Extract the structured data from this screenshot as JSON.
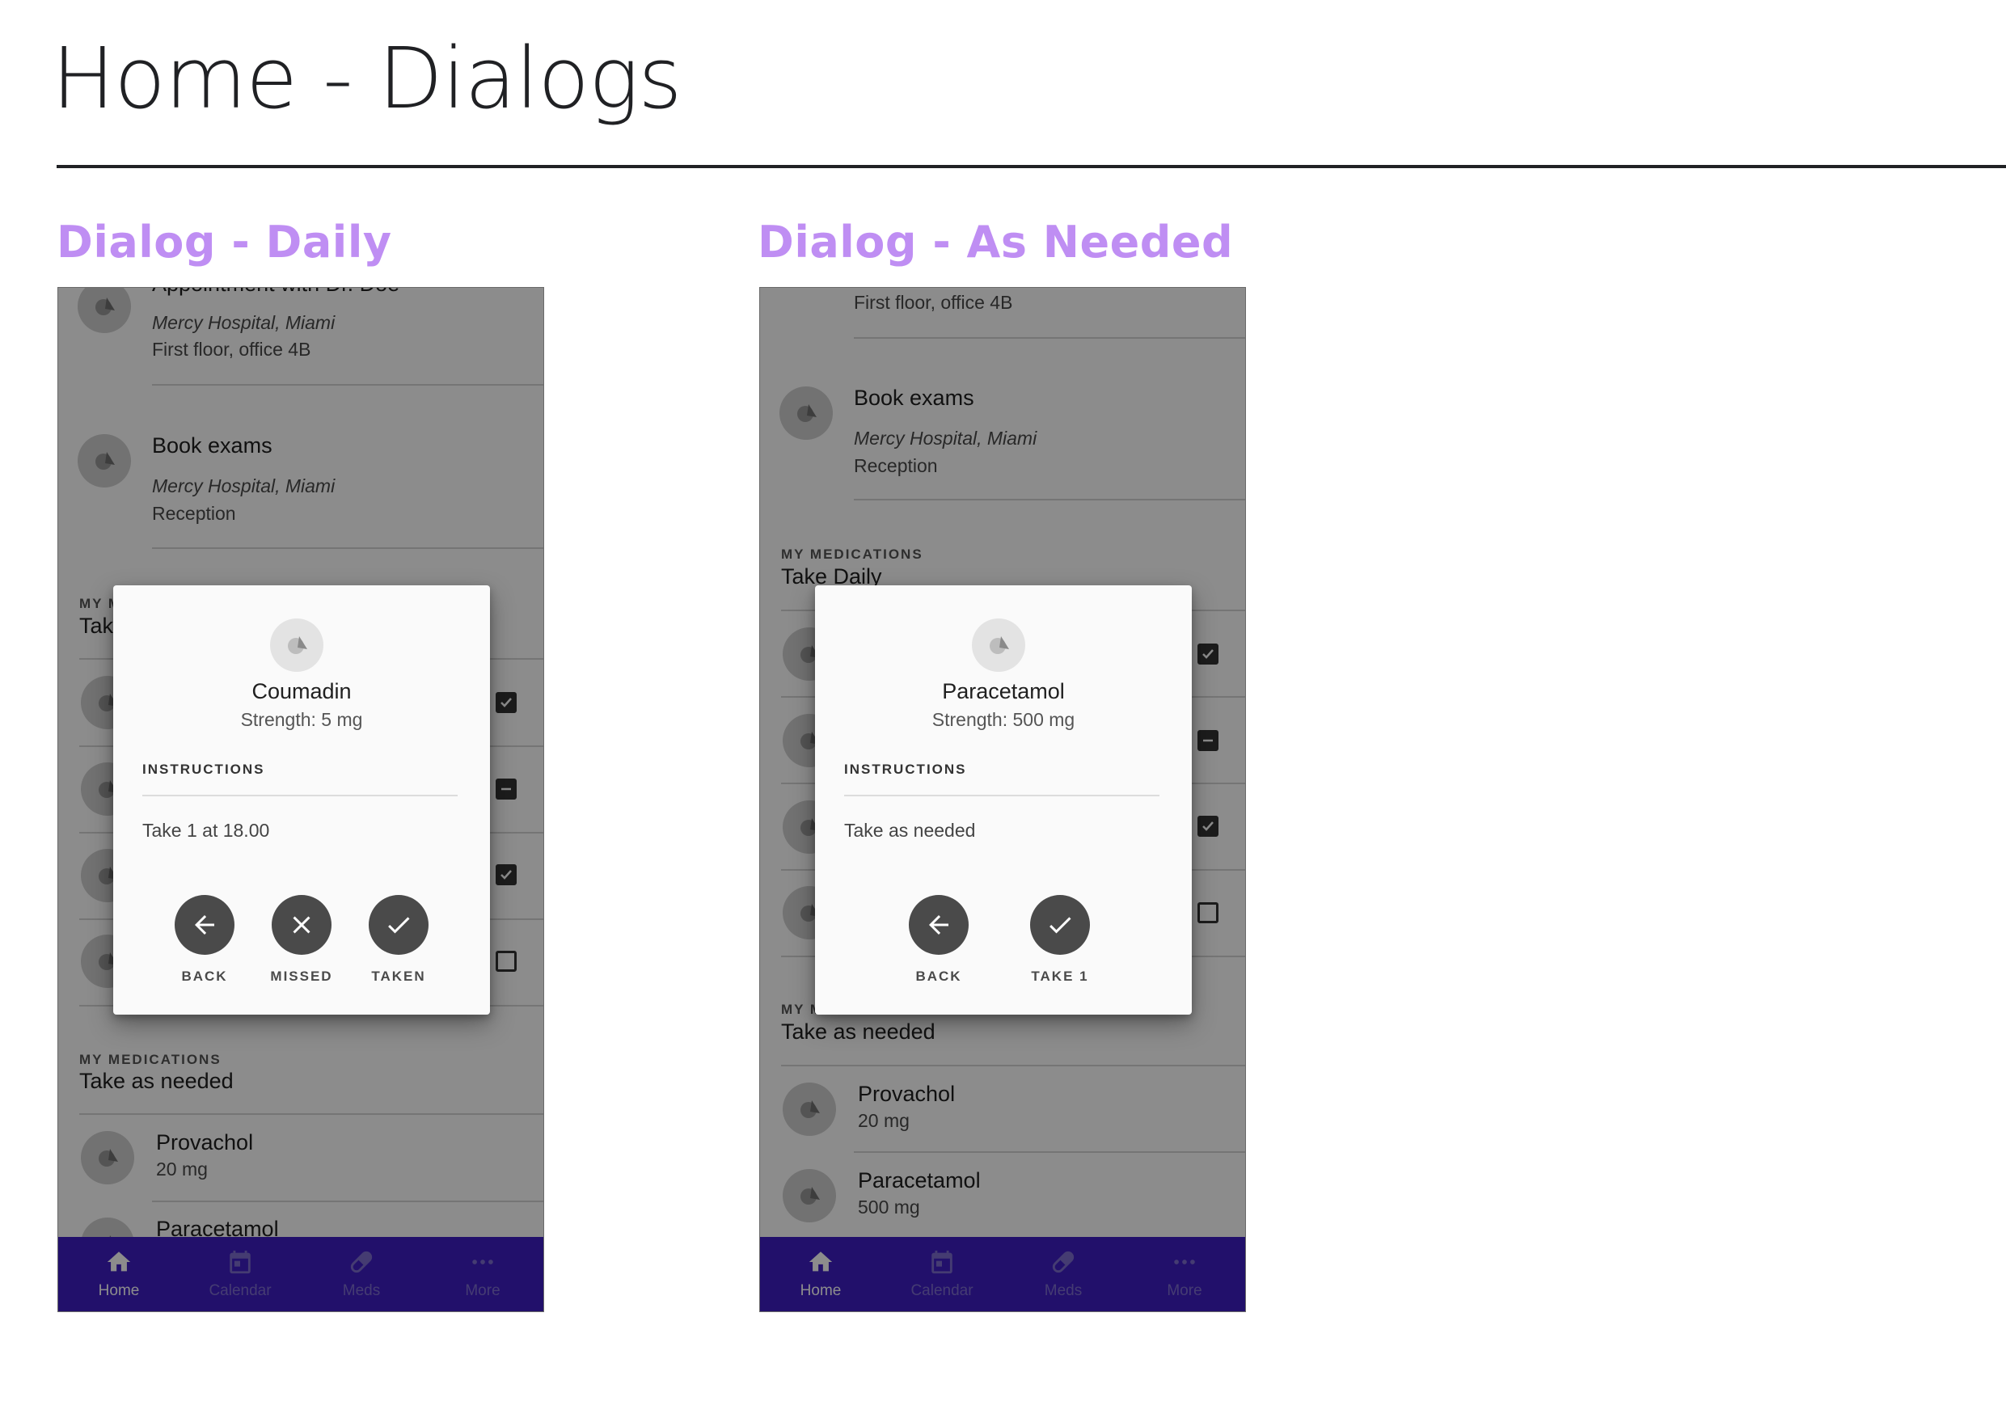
{
  "page": {
    "title": "Home - Dialogs"
  },
  "sections": [
    {
      "title": "Dialog - Daily"
    },
    {
      "title": "Dialog - As Needed"
    }
  ],
  "phone1": {
    "appointment_cut_title": "Appointment with Dr. Doe",
    "appointment_location": "Mercy Hospital, Miami",
    "appointment_detail": "First floor, office 4B",
    "exams_title": "Book exams",
    "exams_location": "Mercy Hospital, Miami",
    "exams_detail": "Reception",
    "daily_overline": "MY MEDICATIONS",
    "daily_header": "Take Daily",
    "needed_overline": "MY MEDICATIONS",
    "needed_header": "Take as needed",
    "needed_items": [
      {
        "name": "Provachol",
        "dose": "20 mg"
      },
      {
        "name": "Paracetamol",
        "dose": ""
      }
    ],
    "checkbox_states": [
      "checked",
      "indeterminate",
      "checked",
      "unchecked"
    ],
    "dialog": {
      "name": "Coumadin",
      "strength": "Strength: 5 mg",
      "instructions_label": "INSTRUCTIONS",
      "instructions": "Take 1 at 18.00",
      "actions": [
        {
          "label": "BACK",
          "icon": "arrow-left-icon"
        },
        {
          "label": "MISSED",
          "icon": "close-icon"
        },
        {
          "label": "TAKEN",
          "icon": "check-icon"
        }
      ]
    }
  },
  "phone2": {
    "appointment_detail": "First floor, office 4B",
    "exams_title": "Book exams",
    "exams_location": "Mercy Hospital, Miami",
    "exams_detail": "Reception",
    "daily_overline": "MY MEDICATIONS",
    "daily_header": "Take Daily",
    "needed_overline": "MY MEDICATIONS",
    "needed_header": "Take as needed",
    "needed_items": [
      {
        "name": "Provachol",
        "dose": "20 mg"
      },
      {
        "name": "Paracetamol",
        "dose": "500 mg"
      }
    ],
    "checkbox_states": [
      "checked",
      "indeterminate",
      "checked",
      "unchecked"
    ],
    "dialog": {
      "name": "Paracetamol",
      "strength": "Strength: 500 mg",
      "instructions_label": "INSTRUCTIONS",
      "instructions": "Take as needed",
      "actions": [
        {
          "label": "BACK",
          "icon": "arrow-left-icon"
        },
        {
          "label": "TAKE 1",
          "icon": "check-icon"
        }
      ]
    }
  },
  "nav": {
    "items": [
      {
        "label": "Home",
        "icon": "home-icon",
        "active": true
      },
      {
        "label": "Calendar",
        "icon": "calendar-icon",
        "active": false
      },
      {
        "label": "Meds",
        "icon": "pill-icon",
        "active": false
      },
      {
        "label": "More",
        "icon": "more-icon",
        "active": false
      }
    ]
  },
  "colors": {
    "section_title": "#bf8ef3",
    "nav_bar": "#3f1ec4",
    "dialog_button": "#4a4a4a"
  }
}
